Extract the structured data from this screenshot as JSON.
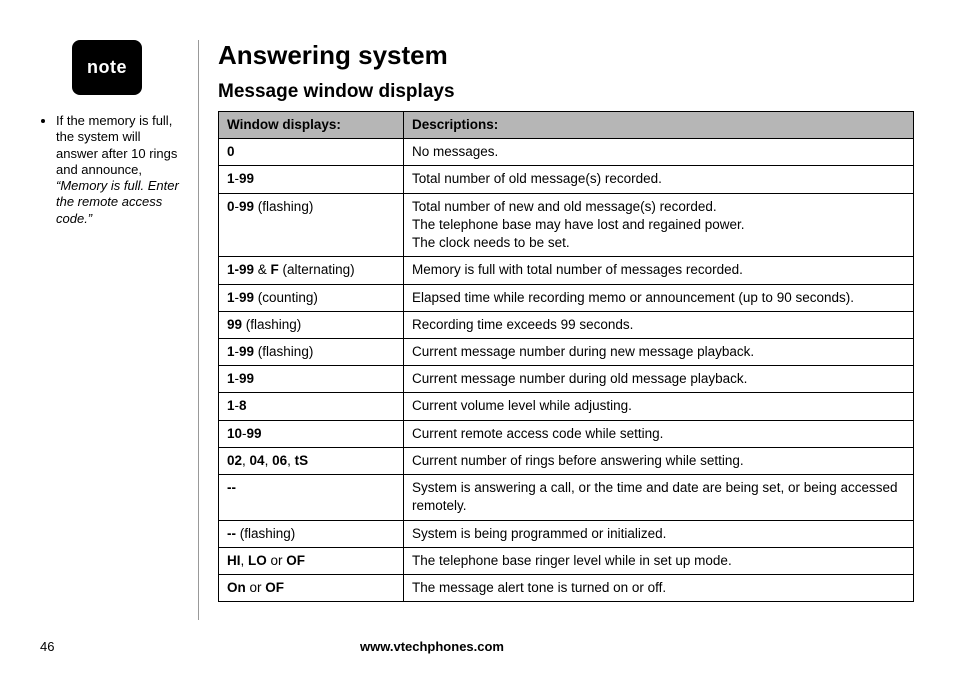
{
  "note_badge": "note",
  "side_note": {
    "lead": "If the memory is full, the system will answer after 10 rings and announce, ",
    "quote": "“Memory is full. Enter the remote access code.”"
  },
  "heading": "Answering system",
  "subheading": "Message window displays",
  "table": {
    "col1_header": "Window displays:",
    "col2_header": "Descriptions:",
    "rows": [
      {
        "display_bold": "0",
        "display_rest": "",
        "desc": "No messages."
      },
      {
        "display_bold": "1",
        "display_rest": "-",
        "display_bold2": "99",
        "desc": "Total number of old message(s) recorded."
      },
      {
        "display_bold": "0",
        "display_rest": "-",
        "display_bold2": "99",
        "display_tail": " (flashing)",
        "desc": "Total number of new and old message(s) recorded.\nThe telephone base may have lost and regained power.\nThe clock needs to be set."
      },
      {
        "display_bold": "1-99",
        "display_rest": " & ",
        "display_bold2": "F",
        "display_tail": " (alternating)",
        "desc": "Memory is full with total number of messages recorded."
      },
      {
        "display_bold": "1",
        "display_rest": "-",
        "display_bold2": "99",
        "display_tail": " (counting)",
        "desc": "Elapsed time while recording memo or announcement (up to 90 seconds)."
      },
      {
        "display_bold": "99",
        "display_tail": " (flashing)",
        "desc": "Recording time exceeds 99 seconds."
      },
      {
        "display_bold": "1",
        "display_rest": "-",
        "display_bold2": "99",
        "display_tail": " (flashing)",
        "desc": "Current message number during new message playback."
      },
      {
        "display_bold": "1",
        "display_rest": "-",
        "display_bold2": "99",
        "desc": "Current message number during old message playback."
      },
      {
        "display_bold": "1",
        "display_rest": "-",
        "display_bold2": "8",
        "desc": "Current volume level while adjusting."
      },
      {
        "display_bold": "10",
        "display_rest": "-",
        "display_bold2": "99",
        "desc": "Current remote access code while setting."
      },
      {
        "display_bold": "02",
        "display_rest": ", ",
        "display_bold2": "04",
        "display_rest2": ", ",
        "display_bold3": "06",
        "display_rest3": ", ",
        "display_bold4": "tS",
        "desc": "Current number of rings before answering while setting."
      },
      {
        "display_bold": "--",
        "desc": "System is answering a call, or the time and date are being set, or being accessed remotely."
      },
      {
        "display_bold": "--",
        "display_tail": " (flashing)",
        "desc": "System is being programmed or initialized."
      },
      {
        "display_bold": "HI",
        "display_rest": ", ",
        "display_bold2": "LO",
        "display_rest2": " or ",
        "display_bold3": "OF",
        "desc": "The telephone base ringer level while in set up mode."
      },
      {
        "display_bold": "On",
        "display_rest": " or ",
        "display_bold2": "OF",
        "desc": "The message alert tone is turned on or off."
      }
    ]
  },
  "footer": {
    "page_number": "46",
    "site": "www.vtechphones.com"
  }
}
